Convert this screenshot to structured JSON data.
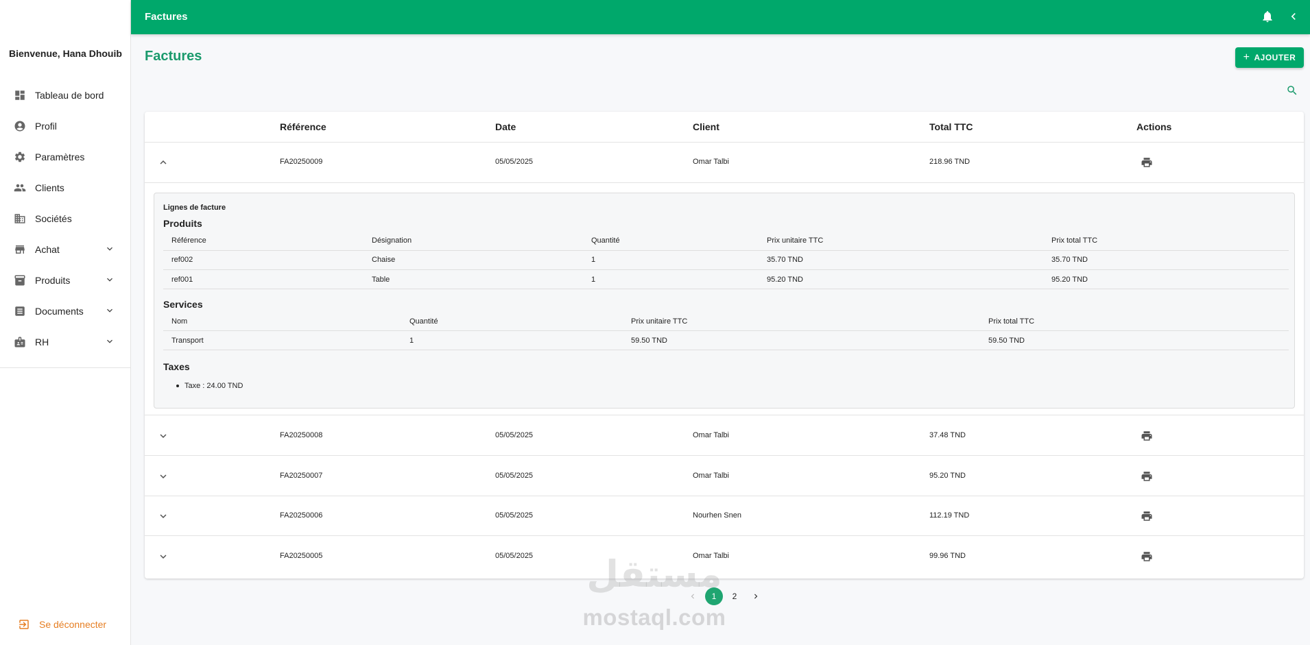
{
  "app": {
    "title": "Factures",
    "welcome": "Bienvenue, Hana Dhouib"
  },
  "sidebar": {
    "items": [
      {
        "label": "Tableau de bord",
        "icon": "dashboard-icon"
      },
      {
        "label": "Profil",
        "icon": "account-circle-icon"
      },
      {
        "label": "Paramètres",
        "icon": "gear-icon"
      },
      {
        "label": "Clients",
        "icon": "people-icon"
      },
      {
        "label": "Sociétés",
        "icon": "building-icon"
      },
      {
        "label": "Achat",
        "icon": "store-icon",
        "expandable": true
      },
      {
        "label": "Produits",
        "icon": "archive-icon",
        "expandable": true
      },
      {
        "label": "Documents",
        "icon": "receipt-icon",
        "expandable": true
      },
      {
        "label": "RH",
        "icon": "badge-icon",
        "expandable": true
      }
    ],
    "logout": "Se déconnecter"
  },
  "main": {
    "title": "Factures",
    "add_label": "AJOUTER",
    "columns": [
      "Référence",
      "Date",
      "Client",
      "Total TTC",
      "Actions"
    ],
    "rows": [
      {
        "ref": "FA20250009",
        "date": "05/05/2025",
        "client": "Omar Talbi",
        "total": "218.96 TND",
        "expanded": true
      },
      {
        "ref": "FA20250008",
        "date": "05/05/2025",
        "client": "Omar Talbi",
        "total": "37.48 TND"
      },
      {
        "ref": "FA20250007",
        "date": "05/05/2025",
        "client": "Omar Talbi",
        "total": "95.20 TND"
      },
      {
        "ref": "FA20250006",
        "date": "05/05/2025",
        "client": "Nourhen Snen",
        "total": "112.19 TND"
      },
      {
        "ref": "FA20250005",
        "date": "05/05/2025",
        "client": "Omar Talbi",
        "total": "99.96 TND"
      }
    ]
  },
  "detail": {
    "caption": "Lignes de facture",
    "products": {
      "title": "Produits",
      "columns": [
        "Référence",
        "Désignation",
        "Quantité",
        "Prix unitaire TTC",
        "Prix total TTC"
      ],
      "rows": [
        [
          "ref002",
          "Chaise",
          "1",
          "35.70 TND",
          "35.70 TND"
        ],
        [
          "ref001",
          "Table",
          "1",
          "95.20 TND",
          "95.20 TND"
        ]
      ]
    },
    "services": {
      "title": "Services",
      "columns": [
        "Nom",
        "Quantité",
        "Prix unitaire TTC",
        "Prix total TTC"
      ],
      "rows": [
        [
          "Transport",
          "1",
          "59.50 TND",
          "59.50 TND"
        ]
      ]
    },
    "taxes": {
      "title": "Taxes",
      "items": [
        "Taxe : 24.00 TND"
      ]
    }
  },
  "pagination": {
    "pages": [
      "1",
      "2"
    ],
    "current": "1"
  },
  "watermark": {
    "text": "mostaql.com",
    "arabic": "مستقل"
  },
  "colors": {
    "primary": "#00a86b",
    "accent_text": "#1a9a6c",
    "logout": "#e67e22"
  }
}
